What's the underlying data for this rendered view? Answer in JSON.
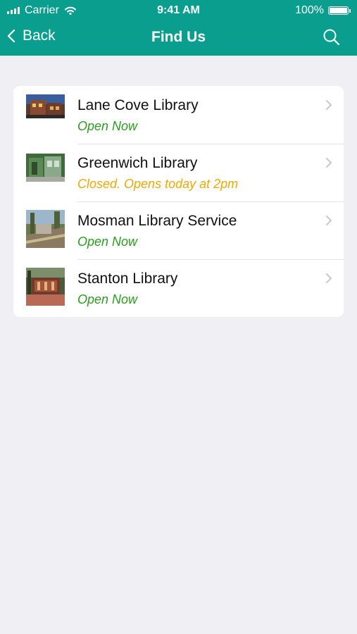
{
  "status_bar": {
    "carrier": "Carrier",
    "time": "9:41 AM",
    "battery": "100%",
    "wifi_icon": "wifi-icon",
    "signal_icon": "signal-bars-icon"
  },
  "nav": {
    "back_label": "Back",
    "title": "Find Us",
    "search_icon": "search-icon",
    "back_icon": "chevron-left-icon"
  },
  "colors": {
    "accent": "#0a9e8f",
    "open": "#2a9d1f",
    "closed": "#f0a800",
    "background": "#efeff4"
  },
  "libraries": [
    {
      "name": "Lane Cove Library",
      "status": "Open Now",
      "state": "open"
    },
    {
      "name": "Greenwich Library",
      "status": "Closed. Opens today at 2pm",
      "state": "closed"
    },
    {
      "name": "Mosman Library Service",
      "status": "Open Now",
      "state": "open"
    },
    {
      "name": "Stanton Library",
      "status": "Open Now",
      "state": "open"
    }
  ]
}
